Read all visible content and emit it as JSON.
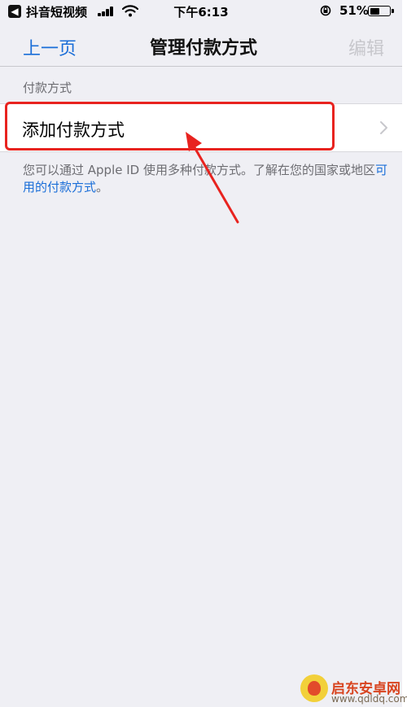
{
  "status_bar": {
    "back_glyph": "◀",
    "app_name": "抖音短视频",
    "time": "下午6:13",
    "battery_pct_text": "51%",
    "battery_level": 0.51
  },
  "nav": {
    "back_label": "上一页",
    "title": "管理付款方式",
    "edit_label": "编辑"
  },
  "section": {
    "header": "付款方式",
    "cell_label": "添加付款方式"
  },
  "footer": {
    "text_before": "您可以通过 Apple ID 使用多种付款方式。了解在您的国家或地区",
    "link_text": "可用的付款方式",
    "text_after": "。"
  },
  "watermark": {
    "brand": "启东安卓网",
    "url": "www.qdldq.com"
  },
  "colors": {
    "accent": "#1a6ed8",
    "highlight": "#e8231f",
    "background": "#efeff4"
  }
}
